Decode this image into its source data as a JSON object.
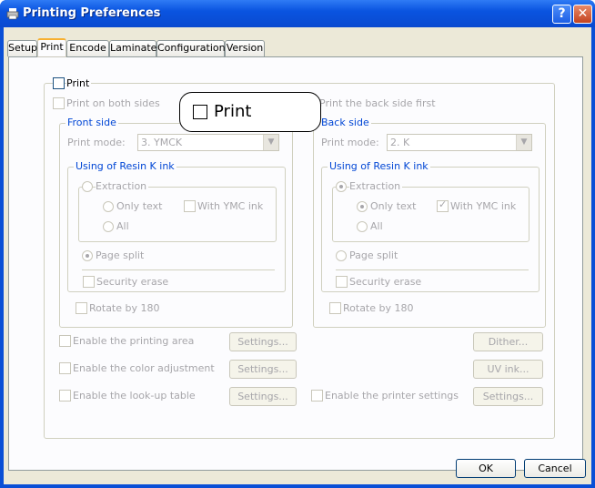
{
  "window": {
    "title": "Printing Preferences",
    "help": "?",
    "close": "✕"
  },
  "tabs": [
    "Setup",
    "Print",
    "Encode",
    "Laminate",
    "Configuration",
    "Version"
  ],
  "print_group": {
    "label": "Print",
    "both_sides": "Print on both sides",
    "back_first": "Print the back side first"
  },
  "callout": {
    "label": "Print"
  },
  "front": {
    "title": "Front side",
    "mode_label": "Print mode:",
    "mode_value": "3. YMCK",
    "resin_title": "Using of Resin K ink",
    "extraction": "Extraction",
    "only_text": "Only text",
    "with_ymc": "With YMC ink",
    "all": "All",
    "page_split": "Page split",
    "security_erase": "Security erase",
    "rotate": "Rotate by 180"
  },
  "back": {
    "title": "Back side",
    "mode_label": "Print mode:",
    "mode_value": "2. K",
    "resin_title": "Using of Resin K ink",
    "extraction": "Extraction",
    "only_text": "Only text",
    "with_ymc": "With YMC ink",
    "all": "All",
    "page_split": "Page split",
    "security_erase": "Security erase",
    "rotate": "Rotate by 180"
  },
  "options": {
    "printing_area": "Enable the printing area",
    "color_adjust": "Enable the color adjustment",
    "lookup": "Enable the look-up table",
    "printer_settings": "Enable the printer settings",
    "settings": "Settings...",
    "dither": "Dither...",
    "uv": "UV ink..."
  },
  "footer": {
    "ok": "OK",
    "cancel": "Cancel"
  },
  "colors": {
    "accent": "#0046d5",
    "title_bar": "#0a54e0",
    "disabled_text": "#a7a6aa"
  }
}
